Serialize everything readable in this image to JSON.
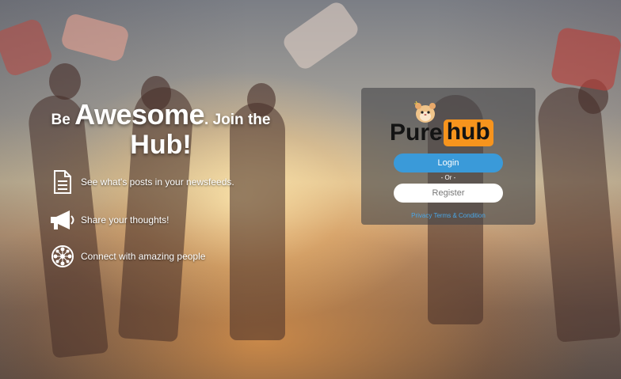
{
  "headline": {
    "prefix": "Be",
    "emphasis": "Awesome",
    "suffix": ". Join the",
    "line2": "Hub!"
  },
  "features": [
    {
      "icon": "document-icon",
      "text": "See what's posts in your newsfeeds."
    },
    {
      "icon": "megaphone-icon",
      "text": "Share your thoughts!"
    },
    {
      "icon": "network-icon",
      "text": "Connect with amazing people"
    }
  ],
  "login": {
    "logo_part1": "Pure",
    "logo_part2": "hub",
    "login_label": "Login",
    "or_label": "- Or -",
    "register_label": "Register",
    "privacy_label": "Privacy Terms & Condition"
  },
  "colors": {
    "login_button": "#3a9ad9",
    "logo_accent": "#f7941d",
    "link": "#4aa6e6"
  }
}
